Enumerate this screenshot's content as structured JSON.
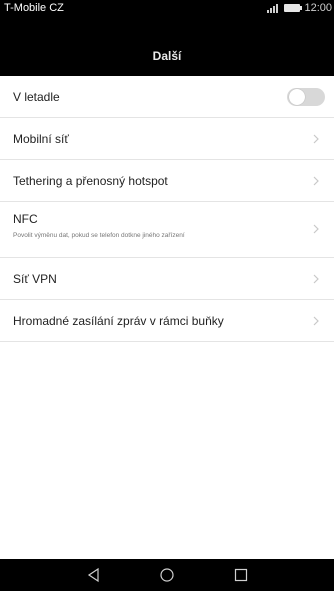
{
  "status_bar": {
    "carrier": "T-Mobile CZ",
    "time": "12:00"
  },
  "header": {
    "title": "Další"
  },
  "items": [
    {
      "label": "V letadle",
      "control": "toggle",
      "toggle_on": false
    },
    {
      "label": "Mobilní síť",
      "control": "chevron"
    },
    {
      "label": "Tethering a přenosný hotspot",
      "control": "chevron"
    },
    {
      "label": "NFC",
      "sublabel": "Povolit výměnu dat, pokud se telefon dotkne jiného zařízení",
      "control": "chevron"
    },
    {
      "label": "Síť VPN",
      "control": "chevron"
    },
    {
      "label": "Hromadné zasílání zpráv v rámci buňky",
      "control": "chevron"
    }
  ],
  "nav_bar": {
    "icons": [
      "back-icon",
      "home-icon",
      "recents-icon"
    ]
  }
}
